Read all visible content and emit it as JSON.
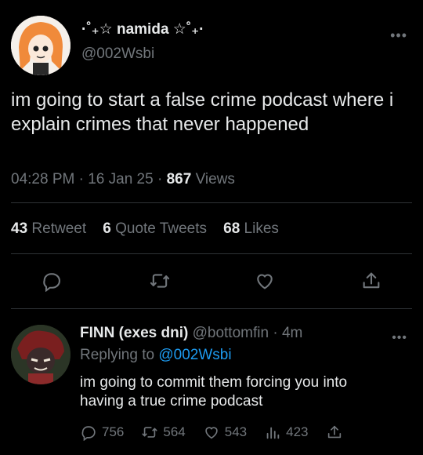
{
  "tweet": {
    "author_name": "·˚₊☆ namida ☆˚₊·",
    "author_handle": "@002Wsbi",
    "text": "im going to start a false crime podcast where i explain crimes that never happened",
    "time": "04:28 PM",
    "date": "16 Jan 25",
    "views_count": "867",
    "views_label": "Views",
    "retweets_count": "43",
    "retweets_label": "Retweet",
    "quotes_count": "6",
    "quotes_label": "Quote Tweets",
    "likes_count": "68",
    "likes_label": "Likes",
    "more": "•••"
  },
  "reply": {
    "author_name": "FINN (exes dni)",
    "author_handle": "@bottomfin",
    "time_ago": "4m",
    "replying_label": "Replying to",
    "replying_handle": "@002Wsbi",
    "text": "im going to commit them forcing you into having a true crime podcast",
    "replies": "756",
    "retweets": "564",
    "likes": "543",
    "views": "423",
    "more": "•••"
  },
  "icons": [
    "reply-icon",
    "retweet-icon",
    "like-icon",
    "share-icon",
    "views-icon",
    "more-icon"
  ],
  "colors": {
    "background": "#000000",
    "text": "#e7e9ea",
    "muted": "#71767b",
    "link": "#1d9bf0",
    "divider": "#2f3336"
  }
}
